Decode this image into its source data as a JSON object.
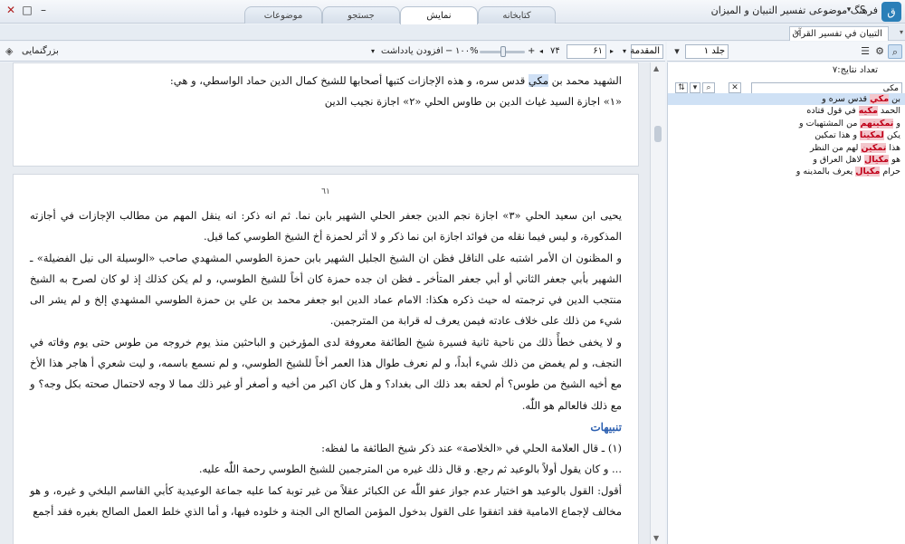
{
  "app": {
    "title": "فرهنگ موضوعی تفسیر التبیان و المیزان",
    "help": "؟",
    "logo": "ق"
  },
  "tabs": [
    {
      "label": "کتابخانه"
    },
    {
      "label": "نمایش"
    },
    {
      "label": "جستجو"
    },
    {
      "label": "موضوعات"
    }
  ],
  "doc_tab": {
    "label": "التبيان في تفسير القرآن"
  },
  "toolbar": {
    "zoom_label": "بزرگنمایی",
    "volume": "جلد ۱",
    "section": "المقدمة",
    "page_from": "۶۱",
    "page_to": "۷۴",
    "zoom": "۱۰۰%",
    "add_note": "افزودن یادداشت"
  },
  "right_panel": {
    "result_count": "تعداد نتایج:۷",
    "search_value": "مکی",
    "results": [
      {
        "before": "بن ",
        "match": "مكي",
        "after": " قدس سره و"
      },
      {
        "before": "الحمد ",
        "match": "مكيه",
        "after": " في قول قتاده"
      },
      {
        "before": "و ",
        "match": "تمكينهم",
        "after": " من المشتهيات و"
      },
      {
        "before": "يكن ",
        "match": "لمكينا",
        "after": " و هذا تمكين"
      },
      {
        "before": "هذا ",
        "match": "تمكين",
        "after": " لهم من النظر"
      },
      {
        "before": "هو ",
        "match": "مكيال",
        "after": " لاهل العراق و"
      },
      {
        "before": "حرام ",
        "match": "مكيال",
        "after": " يعرف بالمدينه و"
      }
    ]
  },
  "content": {
    "page1": {
      "line1_before": "الشهيد محمد بن ",
      "line1_highlight": "مكي",
      "line1_after": " قدس سره، و هذه الإجازات كتبها أصحابها للشيخ كمال الدين حماد الواسطي، و هي:",
      "line2": "«١» اجازة السيد غياث الدين بن طاوس الحلي «٢» اجازة نجيب الدين"
    },
    "page2": {
      "page_number": "٦١",
      "p1": "يحيى ابن سعيد الحلي «٣» اجازة نجم الدين جعفر الحلي الشهير بابن نما. ثم انه ذكر: انه ينقل المهم من مطالب الإجازات في أجازته المذكورة، و ليس فيما نقله من فوائد اجازة ابن نما ذكر و لا أثر لحمزة أخ الشيخ الطوسي كما قيل.",
      "p2": "و المظنون ان الأمر اشتبه على الناقل فظن ان الشيخ الجليل الشهير بابن حمزة الطوسي المشهدي صاحب «الوسيلة الى نيل الفضيلة» ـ الشهير بأبي جعفر الثاني أو أبي جعفر المتأخر ـ فظن ان جده حمزة كان أخاً للشيخ الطوسي، و لم يكن كذلك إذ لو كان لصرح به الشيخ منتجب الدين في ترجمته له حيث ذكره هكذا: الامام عماد الدين ابو جعفر محمد بن علي بن حمزة الطوسي المشهدي إلخ و لم يشر الى شيء من ذلك على خلاف عادته فيمن يعرف له قرابة من المترجمين.",
      "p3": "و لا يخفى خطأً ذلك من ناحية ثانية فسيرة شيخ الطائفة معروفة لدى المؤرخين و الباحثين منذ يوم خروجه من طوس حتى يوم وفاته في النجف، و لم يغمض من ذلك شيء أبداً، و لم نعرف طوال هذا العمر أخاً للشيخ الطوسي، و لم نسمع باسمه، و ليت شعري أ هاجر هذا الأخ مع أخيه الشيخ من طوس؟ أم لحقه بعد ذلك الى بغداد؟ و هل كان اكبر من أخيه و أصغر أو غير ذلك مما لا وجه لاحتمال صحته بكل وجه؟ و مع ذلك فالعالم هو اللّٰه.",
      "section_title": "تنبيهات",
      "p4": "(١) ـ قال العلامة الحلي في «الخلاصة» عند ذكر شيخ الطائفة ما لفظه:",
      "p5": "... و كان يقول أولاً بالوعيد ثم رجع. و قال ذلك غيره من المترجمين للشيخ الطوسي رحمة اللّٰه عليه.",
      "p6": "أقول: القول بالوعيد هو اختيار عدم جواز عفو اللّٰه عن الكبائر عقلاً من غير توبة كما عليه جماعة الوعيدية كأبي القاسم البلخي و غيره، و هو مخالف لإجماع الامامية فقد اتفقوا على القول بدخول المؤمن الصالح الى الجنة و خلوده فيها، و أما الذي خلط العمل الصالح بغيره فقد أجمع"
    }
  }
}
